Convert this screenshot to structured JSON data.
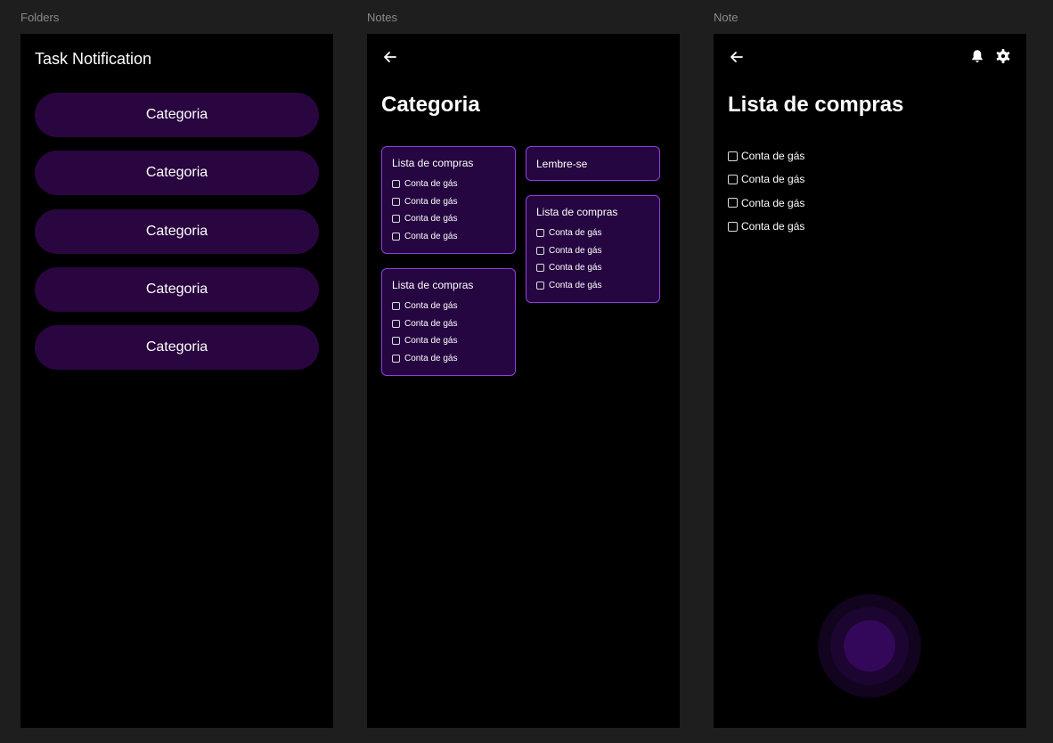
{
  "frames": {
    "folders_label": "Folders",
    "notes_label": "Notes",
    "note_label": "Note"
  },
  "folders": {
    "title": "Task Notification",
    "categories": [
      "Categoria",
      "Categoria",
      "Categoria",
      "Categoria",
      "Categoria"
    ]
  },
  "notes": {
    "title": "Categoria",
    "cards": [
      {
        "title": "Lista de compras",
        "items": [
          "Conta de gás",
          "Conta de gás",
          "Conta de gás",
          "Conta de gás"
        ]
      },
      {
        "title": "Lembre-se"
      },
      {
        "title": "Lista de compras",
        "items": [
          "Conta de gás",
          "Conta de gás",
          "Conta de gás",
          "Conta de gás"
        ]
      },
      {
        "title": "Lista de compras",
        "items": [
          "Conta de gás",
          "Conta de gás",
          "Conta de gás",
          "Conta de gás"
        ]
      }
    ]
  },
  "note": {
    "title": "Lista de compras",
    "items": [
      "Conta de gás",
      "Conta de gás",
      "Conta de gás",
      "Conta de gás"
    ]
  },
  "icons": {
    "back": "arrow-left",
    "bell": "bell",
    "settings": "gear"
  },
  "colors": {
    "background": "#1e1e1e",
    "screen": "#000000",
    "category_button": "#2a0640",
    "card_fill": "#250640",
    "card_border": "#8e3ee0",
    "fab": "#33075a"
  }
}
